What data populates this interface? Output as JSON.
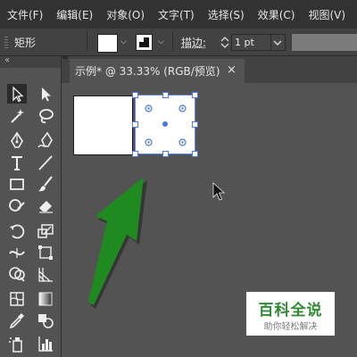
{
  "menu": {
    "items": [
      "文件(F)",
      "编辑(E)",
      "对象(O)",
      "文字(T)",
      "选择(S)",
      "效果(C)",
      "视图(V)"
    ]
  },
  "control_bar": {
    "shape_label": "矩形",
    "stroke_label": "描边",
    "stroke_colon": ":",
    "stroke_weight": "1 pt"
  },
  "toolbar": {
    "collapse_label": "‹‹"
  },
  "document_tab": {
    "title": "示例* @ 33.33% (RGB/预览)",
    "close_label": "×"
  },
  "watermark": {
    "title": "百科全说",
    "subtitle": "助你轻松解决"
  },
  "colors": {
    "menubar_bg": "#323232",
    "control_bg": "#424242",
    "canvas_bg": "#535353",
    "selection_blue": "#4b78e0",
    "arrow_green": "#1f8a1f",
    "watermark_green": "#2f8a34"
  },
  "icons": [
    "selection-tool-icon",
    "direct-selection-tool-icon",
    "magic-wand-icon",
    "lasso-icon",
    "pen-tool-icon",
    "curvature-tool-icon",
    "type-tool-icon",
    "line-segment-icon",
    "rectangle-tool-icon",
    "paintbrush-icon",
    "shaper-icon",
    "eraser-icon",
    "rotate-tool-icon",
    "scale-tool-icon",
    "width-tool-icon",
    "free-transform-icon",
    "shape-builder-icon",
    "perspective-grid-icon",
    "mesh-icon",
    "gradient-icon",
    "eyedropper-icon",
    "blend-icon",
    "symbol-sprayer-icon",
    "column-graph-icon"
  ]
}
